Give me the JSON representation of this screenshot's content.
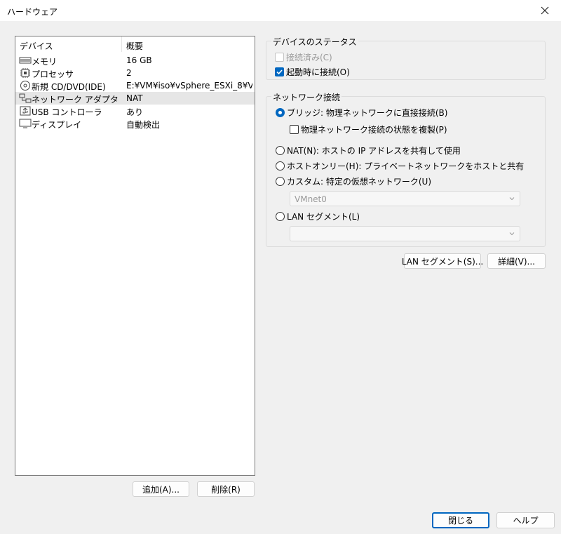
{
  "window": {
    "title": "ハードウェア"
  },
  "device_list": {
    "headers": {
      "device": "デバイス",
      "summary": "概要"
    },
    "rows": [
      {
        "icon": "memory-icon",
        "name": "メモリ",
        "summary": "16 GB"
      },
      {
        "icon": "processor-icon",
        "name": "プロセッサ",
        "summary": "2"
      },
      {
        "icon": "cd-dvd-icon",
        "name": "新規 CD/DVD(IDE)",
        "summary": "E:¥VM¥iso¥vSphere_ESXi_8¥V..."
      },
      {
        "icon": "network-adapter-icon",
        "name": "ネットワーク アダプタ",
        "summary": "NAT"
      },
      {
        "icon": "usb-icon",
        "name": "USB コントローラ",
        "summary": "あり"
      },
      {
        "icon": "display-icon",
        "name": "ディスプレイ",
        "summary": "自動検出"
      }
    ]
  },
  "list_buttons": {
    "add": "追加(A)...",
    "remove": "削除(R)"
  },
  "device_status": {
    "title": "デバイスのステータス",
    "connected": {
      "label": "接続済み(C)",
      "checked": false,
      "disabled": true
    },
    "connect_at_power_on": {
      "label": "起動時に接続(O)",
      "checked": true
    }
  },
  "network_connection": {
    "title": "ネットワーク接続",
    "bridged": "ブリッジ: 物理ネットワークに直接接続(B)",
    "replicate": "物理ネットワーク接続の状態を複製(P)",
    "nat": "NAT(N): ホストの IP アドレスを共有して使用",
    "host_only": "ホストオンリー(H): プライベートネットワークをホストと共有",
    "custom": "カスタム: 特定の仮想ネットワーク(U)",
    "custom_value": "VMnet0",
    "lan_segment": "LAN セグメント(L)",
    "lan_segment_value": ""
  },
  "right_buttons": {
    "lan_segments": "LAN セグメント(S)...",
    "advanced": "詳細(V)..."
  },
  "footer": {
    "close": "閉じる",
    "help": "ヘルプ"
  },
  "colors": {
    "accent": "#0067c0",
    "selected_row": "#e6e6e6"
  }
}
